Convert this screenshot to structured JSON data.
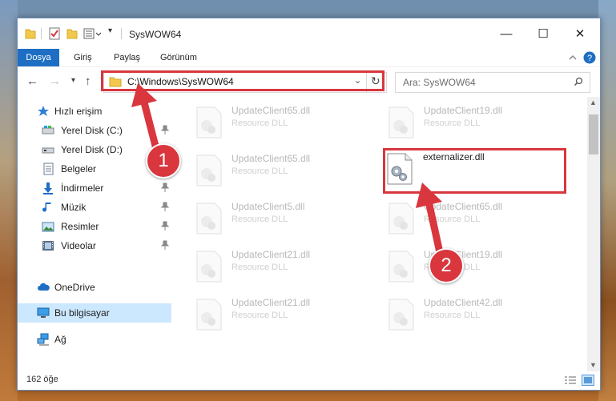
{
  "window": {
    "title": "SysWOW64",
    "minimize_glyph": "—",
    "maximize_glyph": "☐",
    "close_glyph": "✕"
  },
  "ribbon": {
    "tabs": [
      "Dosya",
      "Giriş",
      "Paylaş",
      "Görünüm"
    ]
  },
  "address": {
    "path": "C:\\Windows\\SysWOW64",
    "search_placeholder": "Ara: SysWOW64"
  },
  "nav": {
    "quick_access": "Hızlı erişim",
    "items": [
      {
        "label": "Yerel Disk (C:)",
        "icon": "drive-icon",
        "pinned": true
      },
      {
        "label": "Yerel Disk (D:)",
        "icon": "drive-icon",
        "pinned": false
      },
      {
        "label": "Belgeler",
        "icon": "documents-icon",
        "pinned": false
      },
      {
        "label": "İndirmeler",
        "icon": "downloads-icon",
        "pinned": true
      },
      {
        "label": "Müzik",
        "icon": "music-icon",
        "pinned": true
      },
      {
        "label": "Resimler",
        "icon": "pictures-icon",
        "pinned": true
      },
      {
        "label": "Videolar",
        "icon": "videos-icon",
        "pinned": true
      }
    ],
    "onedrive": "OneDrive",
    "this_pc": "Bu bilgisayar",
    "network": "Ağ"
  },
  "files": [
    {
      "name": "UpdateClient65.dll",
      "type": "Resource DLL"
    },
    {
      "name": "UpdateClient19.dll",
      "type": "Resource DLL"
    },
    {
      "name": "UpdateClient65.dll",
      "type": "Resource DLL"
    },
    {
      "name": "externalizer.dll",
      "type": ""
    },
    {
      "name": "UpdateClient5.dll",
      "type": "Resource DLL"
    },
    {
      "name": "UpdateClient65.dll",
      "type": "Resource DLL"
    },
    {
      "name": "UpdateClient21.dll",
      "type": "Resource DLL"
    },
    {
      "name": "UpdateClient19.dll",
      "type": "Resource DLL"
    },
    {
      "name": "UpdateClient21.dll",
      "type": "Resource DLL"
    },
    {
      "name": "UpdateClient42.dll",
      "type": "Resource DLL"
    }
  ],
  "status": {
    "count": "162 öğe"
  },
  "annotations": {
    "step1": "1",
    "step2": "2"
  },
  "colors": {
    "accent": "#1e6fc4",
    "highlight": "#d9363e",
    "selected": "#cce8ff"
  }
}
